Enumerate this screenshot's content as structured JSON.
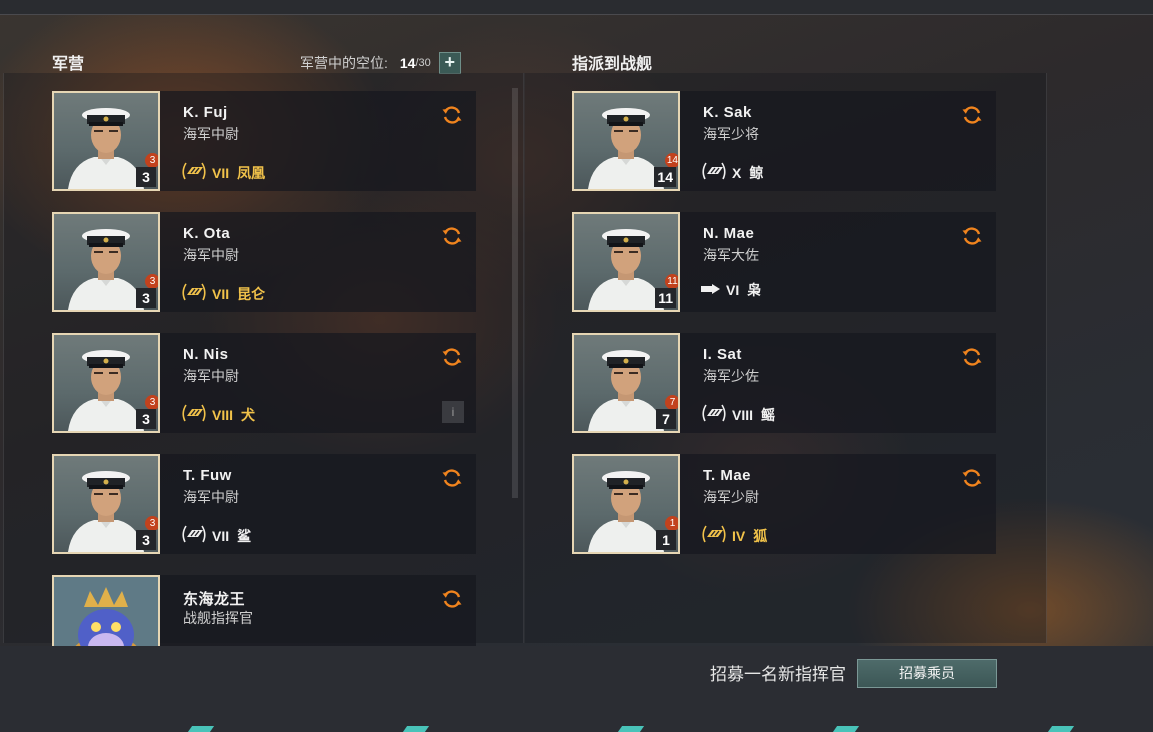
{
  "barracks": {
    "title": "军营",
    "slots_label": "军营中的空位:",
    "slots_used": "14",
    "slots_max": "/30",
    "add_label": "+",
    "commanders": [
      {
        "name": "K. Fuj",
        "rank": "海军中尉",
        "level": "3",
        "skill_points": "3",
        "tier": "VII",
        "ship": "凤凰",
        "ship_color": "gold",
        "ship_icon": "premium-destroyer-icon"
      },
      {
        "name": "K. Ota",
        "rank": "海军中尉",
        "level": "3",
        "skill_points": "3",
        "tier": "VII",
        "ship": "昆仑",
        "ship_color": "gold",
        "ship_icon": "premium-destroyer-icon"
      },
      {
        "name": "N. Nis",
        "rank": "海军中尉",
        "level": "3",
        "skill_points": "3",
        "tier": "VIII",
        "ship": "犬",
        "ship_color": "gold",
        "ship_icon": "premium-destroyer-icon",
        "info": "i"
      },
      {
        "name": "T. Fuw",
        "rank": "海军中尉",
        "level": "3",
        "skill_points": "3",
        "tier": "VII",
        "ship": "鲨",
        "ship_color": "white",
        "ship_icon": "destroyer-icon"
      },
      {
        "name": "东海龙王",
        "rank": "战舰指挥官",
        "level": "",
        "skill_points": "",
        "tier": "",
        "ship": "",
        "ship_color": "gold",
        "ship_icon": "dragon-portrait"
      }
    ]
  },
  "assigned": {
    "title": "指派到战舰",
    "commanders": [
      {
        "name": "K. Sak",
        "rank": "海军少将",
        "level": "14",
        "skill_points": "14",
        "tier": "X",
        "ship": "鲸",
        "ship_color": "white",
        "ship_icon": "destroyer-icon"
      },
      {
        "name": "N. Mae",
        "rank": "海军大佐",
        "level": "11",
        "skill_points": "11",
        "tier": "VI",
        "ship": "枭",
        "ship_color": "white",
        "ship_icon": "battleship-icon"
      },
      {
        "name": "I. Sat",
        "rank": "海军少佐",
        "level": "7",
        "skill_points": "7",
        "tier": "VIII",
        "ship": "鳐",
        "ship_color": "white",
        "ship_icon": "destroyer-icon"
      },
      {
        "name": "T. Mae",
        "rank": "海军少尉",
        "level": "1",
        "skill_points": "1",
        "tier": "IV",
        "ship": "狐",
        "ship_color": "gold",
        "ship_icon": "premium-destroyer-icon"
      }
    ]
  },
  "footer": {
    "recruit_label": "招募一名新指挥官",
    "recruit_button": "招募乘员"
  },
  "colors": {
    "accent": "#f0841e",
    "gold": "#f1c24a",
    "skill_badge": "#c2421d",
    "button": "#44615f"
  }
}
